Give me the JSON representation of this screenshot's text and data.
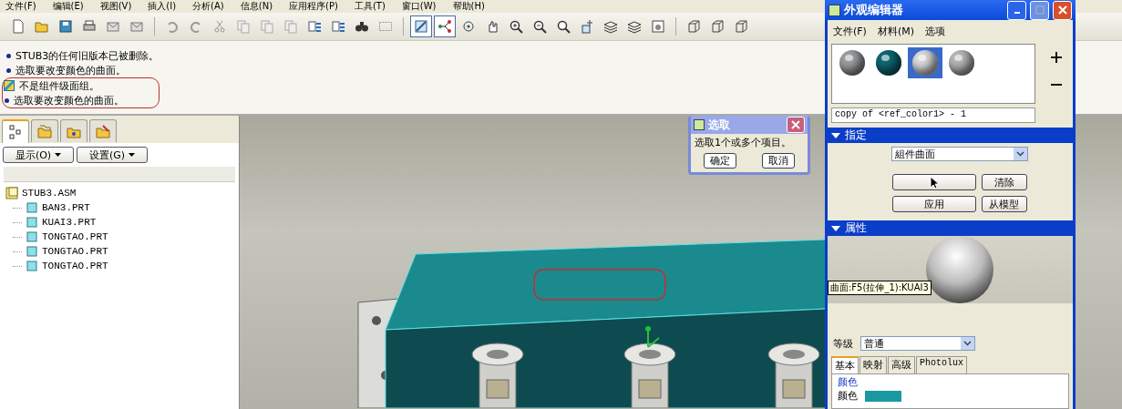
{
  "menu_bar": [
    {
      "label": "文件(F)"
    },
    {
      "label": "编辑(E)"
    },
    {
      "label": "视图(V)"
    },
    {
      "label": "插入(I)"
    },
    {
      "label": "分析(A)"
    },
    {
      "label": "信息(N)"
    },
    {
      "label": "应用程序(P)"
    },
    {
      "label": "工具(T)"
    },
    {
      "label": "窗口(W)"
    },
    {
      "label": "帮助(H)"
    }
  ],
  "toolbar": [
    {
      "selected": false
    },
    {
      "selected": false
    },
    {
      "selected": false
    },
    {
      "selected": false
    },
    {
      "selected": false
    },
    {
      "selected": false
    },
    {
      "selected": false
    },
    {
      "selected": false
    },
    {
      "selected": false
    },
    {
      "selected": false
    },
    {
      "selected": false
    },
    {
      "selected": false
    },
    {
      "selected": false
    },
    {
      "selected": false
    },
    {
      "selected": false
    },
    {
      "selected": false
    },
    {
      "selected": true
    },
    {
      "selected": true
    },
    {
      "selected": false
    },
    {
      "selected": false
    },
    {
      "selected": false
    },
    {
      "selected": false
    },
    {
      "selected": false
    },
    {
      "selected": false
    },
    {
      "selected": false
    },
    {
      "selected": false
    },
    {
      "selected": false
    },
    {
      "selected": false
    },
    {
      "selected": false
    },
    {
      "selected": false
    }
  ],
  "messages": [
    {
      "kind": "info",
      "text": "STUB3的任何旧版本已被删除。",
      "highlighted": false
    },
    {
      "kind": "info",
      "text": "选取要改变颜色的曲面。",
      "highlighted": false
    },
    {
      "kind": "warning",
      "text": "不是组件级面组。",
      "highlighted": true
    },
    {
      "kind": "info",
      "text": "选取要改变颜色的曲面。",
      "highlighted": true
    }
  ],
  "model_tree": {
    "tabs": [
      {
        "selected": true
      },
      {
        "selected": false
      },
      {
        "selected": false
      },
      {
        "selected": false
      }
    ],
    "buttons": [
      "显示(O)",
      "设置(G)"
    ],
    "tree": [
      {
        "label": "STUB3.ASM",
        "kind": "assembly",
        "children": [
          {
            "label": "BAN3.PRT",
            "kind": "part"
          },
          {
            "label": "KUAI3.PRT",
            "kind": "part"
          },
          {
            "label": "TONGTAO.PRT",
            "kind": "part"
          },
          {
            "label": "TONGTAO.PRT",
            "kind": "part"
          },
          {
            "label": "TONGTAO.PRT",
            "kind": "part"
          }
        ]
      }
    ]
  },
  "select_dialog": {
    "title": "选取",
    "message": "选取1个或多个项目。",
    "buttons": [
      "确定",
      "取消"
    ]
  },
  "appearance_editor": {
    "title": "外观编辑器",
    "menu": [
      "文件(F)",
      "材料(M)",
      "选项"
    ],
    "swatches": [
      {
        "color": "#9a9c9e",
        "selected": false
      },
      {
        "color": "#0e6670",
        "selected": false
      },
      {
        "color": "#d8d8d8",
        "selected": true
      },
      {
        "color": "#b4b4b4",
        "selected": false
      }
    ],
    "name": "copy of <ref_color1> - 1",
    "assign": {
      "title": "指定",
      "expanded": true,
      "dropdown": "組件曲面",
      "buttons": [
        "清除",
        "应用",
        "从模型"
      ]
    },
    "properties": {
      "title": "属性",
      "expanded": true,
      "tooltip": "曲面:F5(拉伸_1):KUAI3",
      "level_label": "等级",
      "level_value": "普通",
      "tabs": [
        {
          "label": "基本",
          "selected": true
        },
        {
          "label": "映射",
          "selected": false
        },
        {
          "label": "高级",
          "selected": false
        },
        {
          "label": "Photolux",
          "selected": false
        }
      ],
      "group": "颜色",
      "color_label": "颜色",
      "color": "#1a98a0"
    }
  }
}
